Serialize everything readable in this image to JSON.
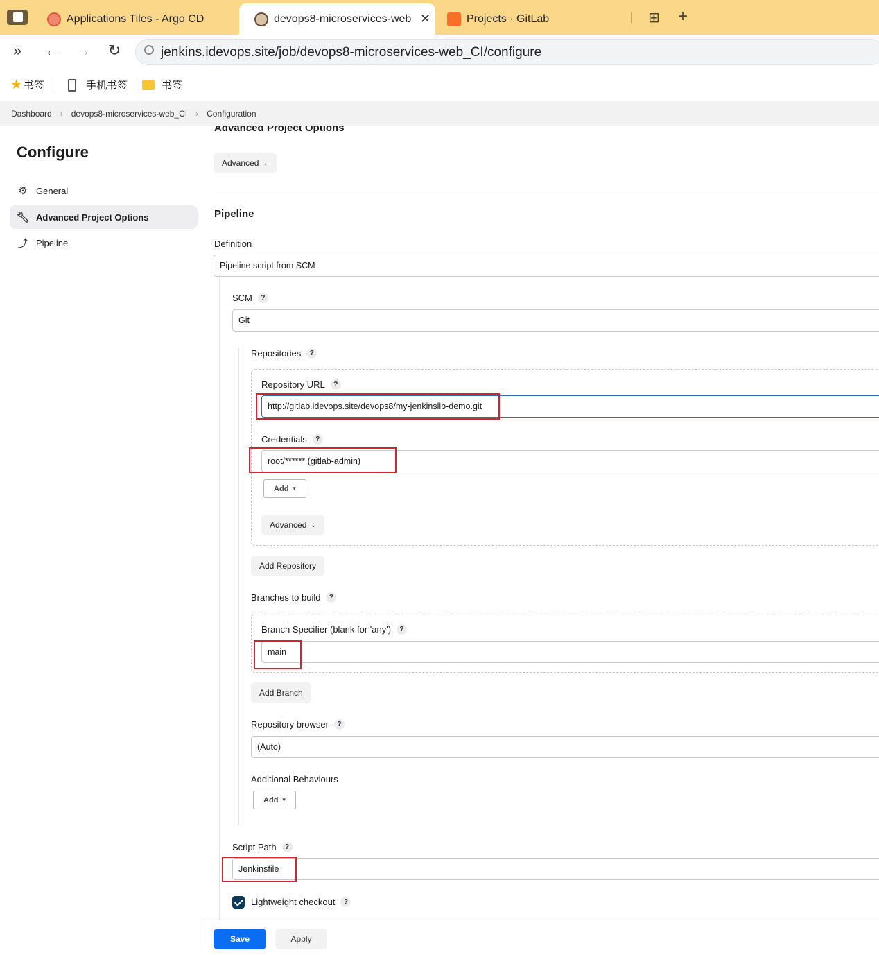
{
  "browser": {
    "tabs": [
      {
        "title": "Applications Tiles - Argo CD",
        "active": false
      },
      {
        "title": "devops8-microservices-web",
        "active": true
      },
      {
        "title": "Projects · GitLab",
        "active": false
      }
    ],
    "address": "jenkins.idevops.site/job/devops8-microservices-web_CI/configure",
    "bookmarks": [
      "书签",
      "手机书签",
      "书签"
    ]
  },
  "breadcrumb": [
    "Dashboard",
    "devops8-microservices-web_CI",
    "Configuration"
  ],
  "sidebar": {
    "title": "Configure",
    "items": [
      {
        "label": "General",
        "icon": "gear-icon",
        "active": false
      },
      {
        "label": "Advanced Project Options",
        "icon": "wrench-icon",
        "active": true
      },
      {
        "label": "Pipeline",
        "icon": "pipeline-icon",
        "active": false
      }
    ]
  },
  "main": {
    "advanced_section_title": "Advanced Project Options",
    "advanced_button": "Advanced",
    "pipeline_title": "Pipeline",
    "definition_label": "Definition",
    "definition_value": "Pipeline script from SCM",
    "scm_label": "SCM",
    "scm_value": "Git",
    "repositories_label": "Repositories",
    "repo_url_label": "Repository URL",
    "repo_url_value": "http://gitlab.idevops.site/devops8/my-jenkinslib-demo.git",
    "credentials_label": "Credentials",
    "credentials_value": "root/****** (gitlab-admin)",
    "add_label": "Add",
    "repo_advanced_button": "Advanced",
    "add_repository_button": "Add Repository",
    "branches_label": "Branches to build",
    "branch_specifier_label": "Branch Specifier (blank for 'any')",
    "branch_specifier_value": "main",
    "add_branch_button": "Add Branch",
    "repo_browser_label": "Repository browser",
    "repo_browser_value": "(Auto)",
    "additional_behaviours_label": "Additional Behaviours",
    "additional_add_label": "Add",
    "script_path_label": "Script Path",
    "script_path_value": "Jenkinsfile",
    "lightweight_label": "Lightweight checkout",
    "lightweight_checked": true,
    "help_glyph": "?"
  },
  "footer": {
    "save_label": "Save",
    "apply_label": "Apply"
  },
  "colors": {
    "tabbar_bg": "#fbd78a",
    "save_button": "#0b6ef2",
    "highlight_box": "#d5242f",
    "checkbox": "#0b3a5a"
  }
}
